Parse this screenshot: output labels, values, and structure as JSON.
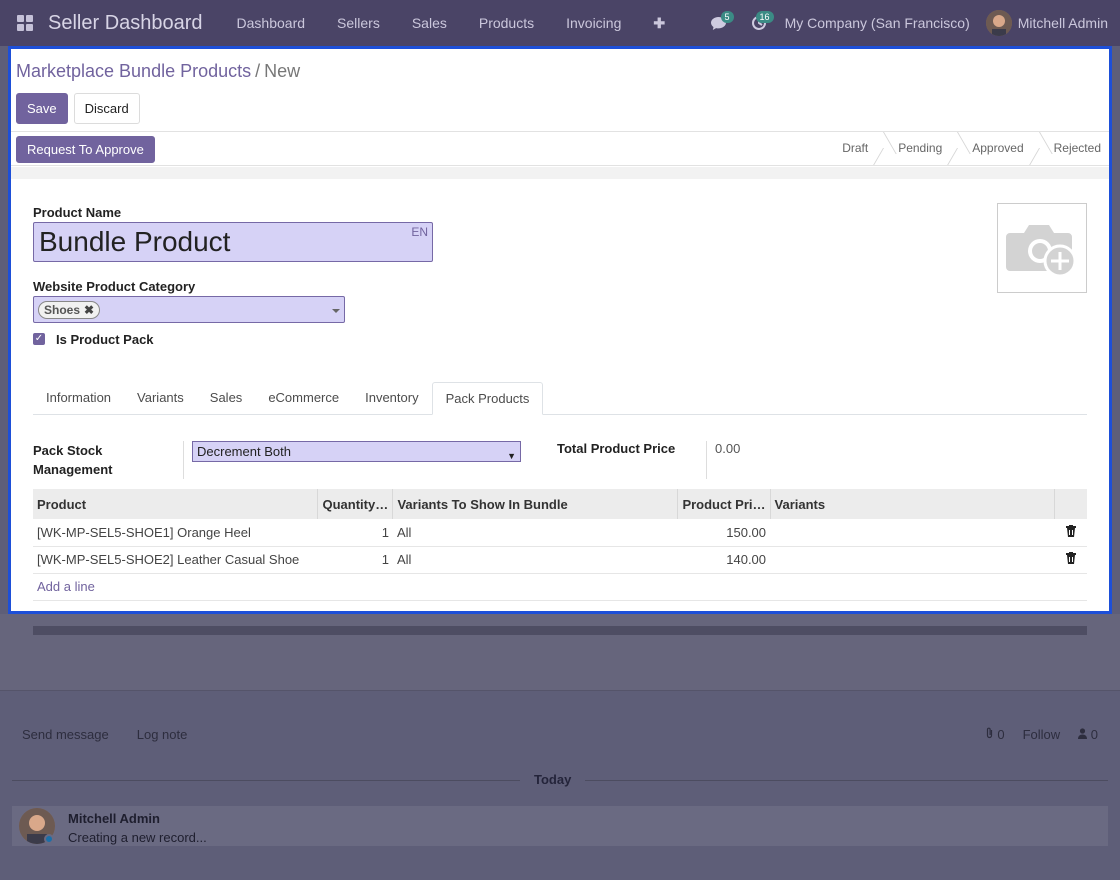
{
  "navbar": {
    "brand": "Seller Dashboard",
    "menu": [
      "Dashboard",
      "Sellers",
      "Sales",
      "Products",
      "Invoicing"
    ],
    "plus": "✚",
    "messages_count": "5",
    "activities_count": "16",
    "company": "My Company (San Francisco)",
    "user": "Mitchell Admin"
  },
  "breadcrumb": {
    "parent": "Marketplace Bundle Products",
    "separator": "/",
    "current": "New"
  },
  "buttons": {
    "save": "Save",
    "discard": "Discard",
    "request_approve": "Request To Approve"
  },
  "stages": [
    "Draft",
    "Pending",
    "Approved",
    "Rejected"
  ],
  "form": {
    "product_name_label": "Product Name",
    "product_name_value": "Bundle Product",
    "lang": "EN",
    "category_label": "Website Product Category",
    "category_tag": "Shoes",
    "is_pack_label": "Is Product Pack",
    "is_pack_checked": true
  },
  "tabs": [
    "Information",
    "Variants",
    "Sales",
    "eCommerce",
    "Inventory",
    "Pack Products"
  ],
  "active_tab": "Pack Products",
  "pack": {
    "stock_mgmt_label": "Pack Stock Management",
    "stock_mgmt_value": "Decrement Both",
    "total_price_label": "Total Product Price",
    "total_price_value": "0.00"
  },
  "table": {
    "headers": [
      "Product",
      "Quantity…",
      "Variants To Show In Bundle",
      "Product Pri…",
      "Variants"
    ],
    "rows": [
      {
        "product": "[WK-MP-SEL5-SHOE1] Orange Heel",
        "qty": "1",
        "variants_show": "All",
        "price": "150.00",
        "variants": ""
      },
      {
        "product": "[WK-MP-SEL5-SHOE2] Leather Casual Shoe",
        "qty": "1",
        "variants_show": "All",
        "price": "140.00",
        "variants": ""
      }
    ],
    "add_line": "Add a line"
  },
  "chatter": {
    "send_message": "Send message",
    "log_note": "Log note",
    "attachments": "0",
    "follow": "Follow",
    "followers": "0",
    "date_separator": "Today",
    "message_author": "Mitchell Admin",
    "message_body": "Creating a new record..."
  },
  "colors": {
    "navbar": "#4a4466",
    "primary": "#71639e",
    "focus_border": "#1d4fd8"
  }
}
